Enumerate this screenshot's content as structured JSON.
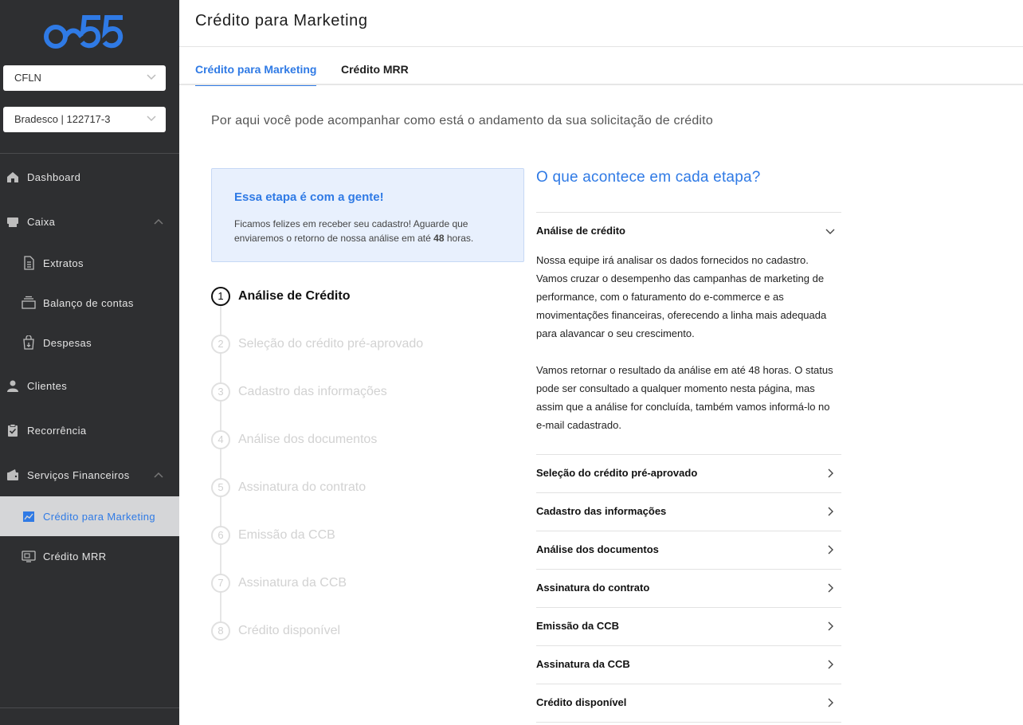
{
  "brand": {
    "logo_text": "o55",
    "accent": "#2f7ae5"
  },
  "sidebar": {
    "company_select": "CFLN",
    "account_select": "Bradesco | 122717-3",
    "items": [
      {
        "label": "Dashboard",
        "icon": "home-icon"
      },
      {
        "label": "Caixa",
        "icon": "cash-register-icon"
      },
      {
        "label": "Extratos",
        "icon": "document-icon"
      },
      {
        "label": "Balanço de contas",
        "icon": "stack-icon"
      },
      {
        "label": "Despesas",
        "icon": "bag-icon"
      },
      {
        "label": "Clientes",
        "icon": "person-icon"
      },
      {
        "label": "Recorrência",
        "icon": "clipboard-check-icon"
      },
      {
        "label": "Serviços Financeiros",
        "icon": "wallet-icon"
      },
      {
        "label": "Crédito para Marketing",
        "icon": "chart-icon"
      },
      {
        "label": "Crédito MRR",
        "icon": "monitor-icon"
      }
    ]
  },
  "header": {
    "title": "Crédito para Marketing"
  },
  "tabs": [
    {
      "label": "Crédito para Marketing"
    },
    {
      "label": "Crédito MRR"
    }
  ],
  "main": {
    "intro": "Por aqui você pode acompanhar como está o andamento da sua solicitação de crédito",
    "info": {
      "title": "Essa etapa é com a gente!",
      "text_before": "Ficamos felizes em receber seu cadastro! Aguarde que enviaremos o retorno de nossa análise em até ",
      "text_bold": "48",
      "text_after": " horas."
    },
    "steps": [
      {
        "num": "1",
        "label": "Análise de Crédito"
      },
      {
        "num": "2",
        "label": "Seleção do crédito pré-aprovado"
      },
      {
        "num": "3",
        "label": "Cadastro das informações"
      },
      {
        "num": "4",
        "label": "Análise dos documentos"
      },
      {
        "num": "5",
        "label": "Assinatura do contrato"
      },
      {
        "num": "6",
        "label": "Emissão da CCB"
      },
      {
        "num": "7",
        "label": "Assinatura da CCB"
      },
      {
        "num": "8",
        "label": "Crédito disponível"
      }
    ],
    "faq": {
      "title": "O que acontece em cada etapa?",
      "items": [
        {
          "title": "Análise de crédito",
          "p1": "Nossa equipe irá analisar os dados fornecidos no cadastro. Vamos cruzar o desempenho das campanhas de marketing de performance, com o faturamento do e-commerce e as movimentações financeiras, oferecendo a linha mais adequada para alavancar o seu crescimento.",
          "p2": "Vamos retornar o resultado da análise em até 48 horas. O status pode ser consultado a qualquer momento nesta página, mas assim que a análise for concluída, também vamos informá-lo no e-mail cadastrado."
        },
        {
          "title": "Seleção do crédito pré-aprovado"
        },
        {
          "title": "Cadastro das informações"
        },
        {
          "title": "Análise dos documentos"
        },
        {
          "title": "Assinatura do contrato"
        },
        {
          "title": "Emissão da CCB"
        },
        {
          "title": "Assinatura da CCB"
        },
        {
          "title": "Crédito disponível"
        }
      ]
    }
  }
}
